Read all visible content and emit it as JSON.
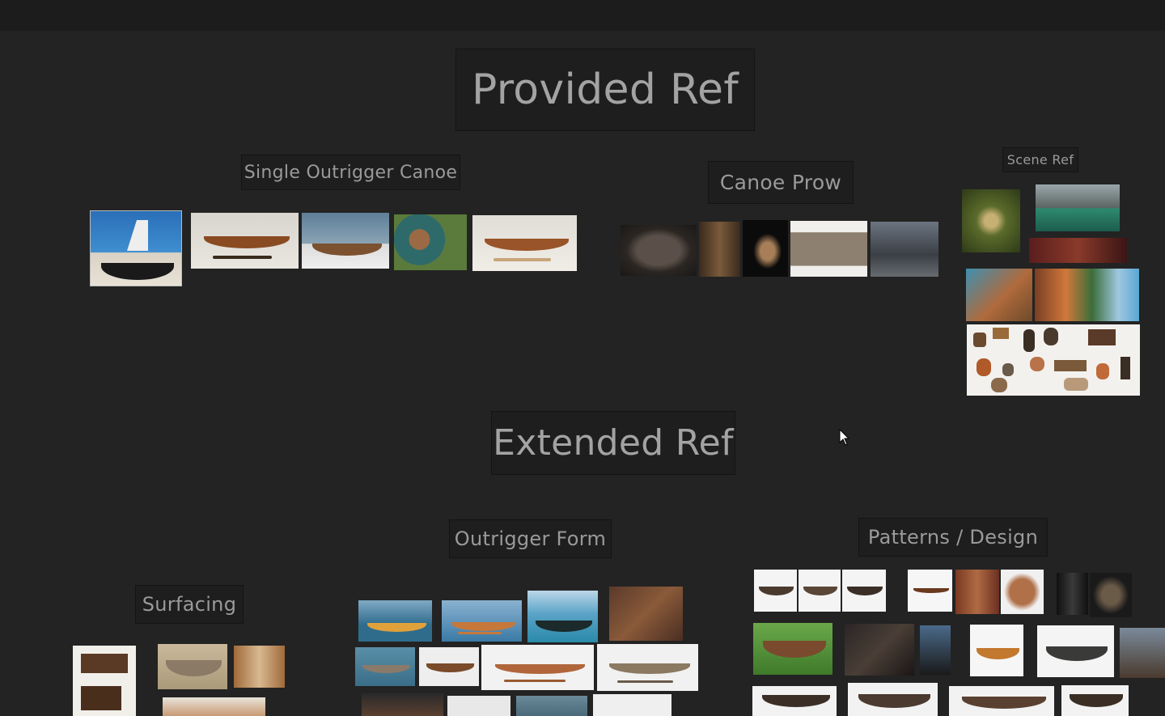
{
  "canvas": {
    "sections": {
      "provided_ref": "Provided Ref",
      "extended_ref": "Extended Ref"
    },
    "groups": {
      "single_outrigger_canoe": "Single Outrigger Canoe",
      "canoe_prow": "Canoe Prow",
      "scene_ref": "Scene Ref",
      "outrigger_form": "Outrigger Form",
      "patterns_design": "Patterns / Design",
      "surfacing": "Surfacing"
    }
  },
  "colors": {
    "background": "#232323",
    "label_bg": "#1e1e1e",
    "label_text": "#9a9a9a"
  },
  "icons": {
    "cursor": "mouse-pointer-icon"
  }
}
